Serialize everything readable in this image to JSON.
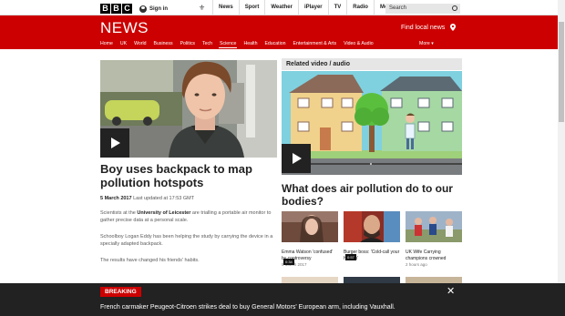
{
  "topbar": {
    "logo_letters": [
      "B",
      "B",
      "C"
    ],
    "sign_in": "Sign in",
    "nav": [
      "News",
      "Sport",
      "Weather",
      "iPlayer",
      "TV",
      "Radio",
      "More"
    ],
    "search_placeholder": "Search"
  },
  "header": {
    "title": "NEWS",
    "find_local": "Find local news",
    "accent": "#cc0000"
  },
  "nav": {
    "items": [
      "Home",
      "UK",
      "World",
      "Business",
      "Politics",
      "Tech",
      "Science",
      "Health",
      "Education",
      "Entertainment & Arts",
      "Video & Audio"
    ],
    "active": "Science",
    "more": "More"
  },
  "article": {
    "headline": "Boy uses backpack to map pollution hotspots",
    "date": "5 March 2017",
    "updated": "Last updated at 17:53 GMT",
    "para1_pre": "Scientists at the ",
    "para1_link": "University of Leicester",
    "para1_post": " are trialling a portable air monitor to gather precise data at a personal scale.",
    "para2": "Schoolboy Logan Eddy has been helping the study by carrying the device in a specially adapted backpack.",
    "para3": "The results have changed his friends' habits."
  },
  "related": {
    "heading": "Related video / audio",
    "headline": "What does air pollution do to our bodies?",
    "thumbs": [
      {
        "duration": "0:34",
        "caption": "Emma Watson 'confused' by controversy",
        "ago": "5 March 2017"
      },
      {
        "duration": "0:57",
        "caption": "Burger boss: 'Cold-call your heroes'",
        "ago": ""
      },
      {
        "duration": "",
        "caption": "UK Wife Carrying champions crowned",
        "ago": "2 hours ago"
      }
    ]
  },
  "breaking": {
    "label": "BREAKING",
    "message": "French carmaker Peugeot-Citroen strikes deal to buy General Motors' European arm, including Vauxhall."
  }
}
